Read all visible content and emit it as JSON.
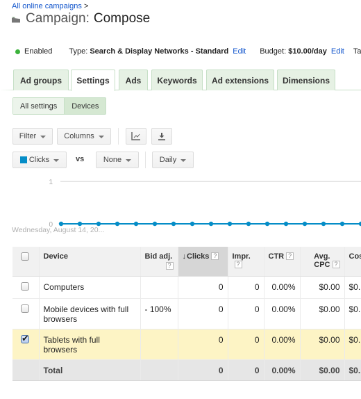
{
  "breadcrumb": {
    "link": "All online campaigns",
    "separator": ">"
  },
  "header": {
    "title_prefix": "Campaign:",
    "campaign_name": "Compose",
    "icon": "folder-icon"
  },
  "status_bar": {
    "status": "Enabled",
    "status_color": "#3bb23b",
    "type_label": "Type:",
    "type_value": "Search & Display Networks - Standard",
    "type_edit": "Edit",
    "budget_label": "Budget:",
    "budget_value": "$10.00/day",
    "budget_edit": "Edit",
    "targeting_label": "Targe"
  },
  "tabs": [
    {
      "label": "Ad groups",
      "active": false
    },
    {
      "label": "Settings",
      "active": true
    },
    {
      "label": "Ads",
      "active": false
    },
    {
      "label": "Keywords",
      "active": false
    },
    {
      "label": "Ad extensions",
      "active": false
    },
    {
      "label": "Dimensions",
      "active": false
    }
  ],
  "subtabs": [
    {
      "label": "All settings",
      "active": false
    },
    {
      "label": "Devices",
      "active": true
    }
  ],
  "toolbar": {
    "filter": "Filter",
    "columns": "Columns",
    "chart_icon": "line-chart-icon",
    "download_icon": "download-icon",
    "metric1": "Clicks",
    "metric1_color": "#058dc7",
    "vs": "vs",
    "metric2": "None",
    "interval": "Daily"
  },
  "chart_data": {
    "type": "line",
    "title": "",
    "xlabel": "Wednesday, August 14, 20...",
    "ylabel": "",
    "yticks": [
      "0",
      "1"
    ],
    "ylim": [
      0,
      1
    ],
    "grid": true,
    "series": [
      {
        "name": "Clicks",
        "color": "#058dc7",
        "values": [
          0,
          0,
          0,
          0,
          0,
          0,
          0,
          0,
          0,
          0,
          0,
          0,
          0,
          0,
          0,
          0,
          0
        ]
      }
    ]
  },
  "table": {
    "columns": [
      {
        "label": "",
        "type": "checkbox"
      },
      {
        "label": "Device",
        "help": false
      },
      {
        "label": "Bid adj.",
        "help": true
      },
      {
        "label": "Clicks",
        "help": true,
        "sorted": "desc"
      },
      {
        "label": "Impr.",
        "help": true
      },
      {
        "label": "CTR",
        "help": true
      },
      {
        "label": "Avg. CPC",
        "help": true
      },
      {
        "label": "Cost",
        "help": false
      }
    ],
    "help_glyph": "?",
    "sort_glyph": "↓",
    "rows": [
      {
        "checked": false,
        "device": "Computers",
        "bid_adj": "",
        "clicks": "0",
        "impr": "0",
        "ctr": "0.00%",
        "avg_cpc": "$0.00",
        "cost": "$0."
      },
      {
        "checked": false,
        "device": "Mobile devices with full browsers",
        "bid_adj": "- 100%",
        "clicks": "0",
        "impr": "0",
        "ctr": "0.00%",
        "avg_cpc": "$0.00",
        "cost": "$0."
      },
      {
        "checked": true,
        "device": "Tablets with full browsers",
        "bid_adj": "",
        "clicks": "0",
        "impr": "0",
        "ctr": "0.00%",
        "avg_cpc": "$0.00",
        "cost": "$0."
      }
    ],
    "total": {
      "label": "Total",
      "clicks": "0",
      "impr": "0",
      "ctr": "0.00%",
      "avg_cpc": "$0.00",
      "cost": "$0."
    }
  }
}
